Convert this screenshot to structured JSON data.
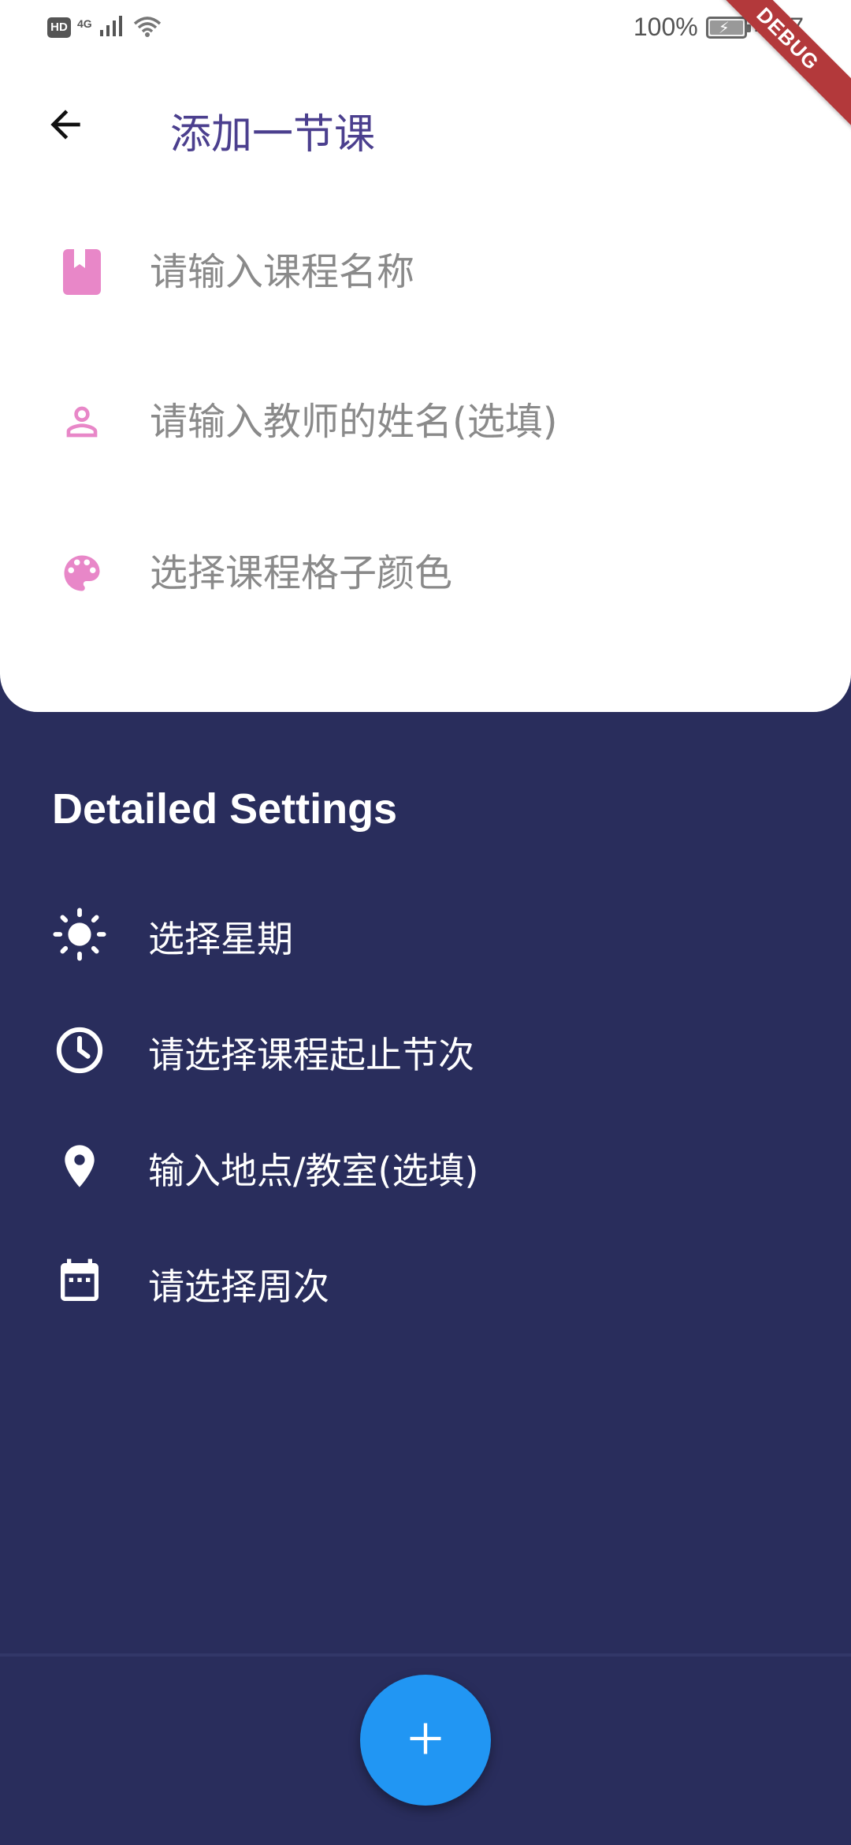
{
  "status_bar": {
    "hd_badge": "HD",
    "network": "4G",
    "battery": "100%",
    "time": "4:47"
  },
  "debug_banner": "DEBUG",
  "app_bar": {
    "title": "添加一节课",
    "back_icon": "arrow-back-icon"
  },
  "form": {
    "course_name": {
      "icon": "book-icon",
      "placeholder": "请输入课程名称",
      "value": ""
    },
    "teacher_name": {
      "icon": "person-icon",
      "placeholder": "请输入教师的姓名(选填)",
      "value": ""
    },
    "cell_color": {
      "icon": "palette-icon",
      "placeholder": "选择课程格子颜色",
      "value": ""
    }
  },
  "detailed_settings": {
    "title": "Detailed Settings",
    "items": [
      {
        "icon": "sun-icon",
        "label": "选择星期"
      },
      {
        "icon": "clock-icon",
        "label": "请选择课程起止节次"
      },
      {
        "icon": "location-pin-icon",
        "label": "输入地点/教室(选填)"
      },
      {
        "icon": "calendar-icon",
        "label": "请选择周次"
      }
    ]
  },
  "fab": {
    "icon": "plus-icon"
  },
  "colors": {
    "accent_pink": "#e887c8",
    "background_navy": "#292d5c",
    "title_purple": "#4b3f8e",
    "fab_blue": "#2196f3",
    "debug_red": "#b3393b"
  }
}
